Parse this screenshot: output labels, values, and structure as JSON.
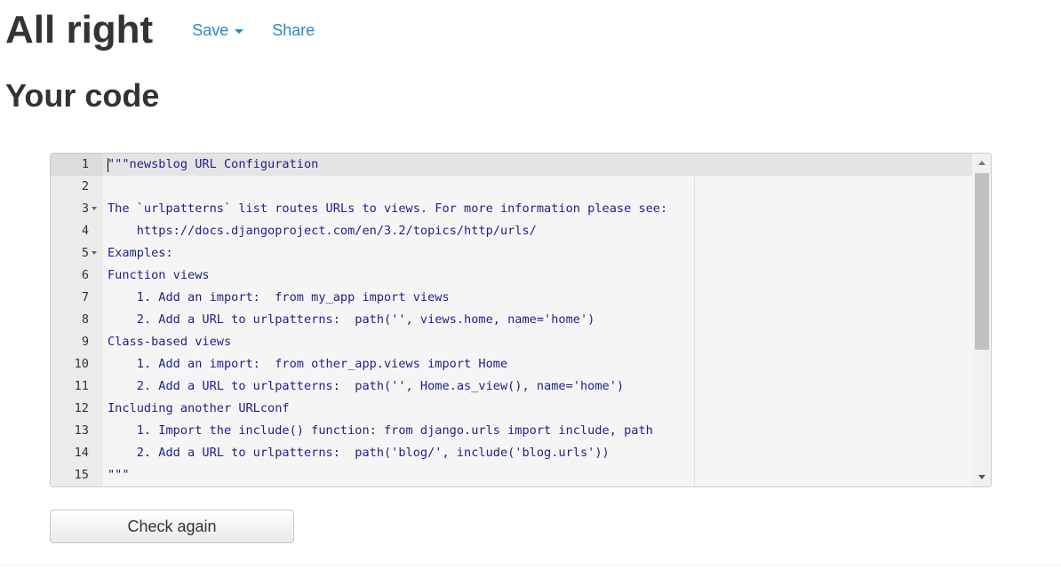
{
  "header": {
    "title": "All right",
    "save_label": "Save",
    "share_label": "Share"
  },
  "section_title": "Your code",
  "editor": {
    "lines": [
      {
        "number": "1",
        "text": "\"\"\"newsblog URL Configuration"
      },
      {
        "number": "2",
        "text": ""
      },
      {
        "number": "3",
        "text": "The `urlpatterns` list routes URLs to views. For more information please see:"
      },
      {
        "number": "4",
        "text": "    https://docs.djangoproject.com/en/3.2/topics/http/urls/"
      },
      {
        "number": "5",
        "text": "Examples:"
      },
      {
        "number": "6",
        "text": "Function views"
      },
      {
        "number": "7",
        "text": "    1. Add an import:  from my_app import views"
      },
      {
        "number": "8",
        "text": "    2. Add a URL to urlpatterns:  path('', views.home, name='home')"
      },
      {
        "number": "9",
        "text": "Class-based views"
      },
      {
        "number": "10",
        "text": "    1. Add an import:  from other_app.views import Home"
      },
      {
        "number": "11",
        "text": "    2. Add a URL to urlpatterns:  path('', Home.as_view(), name='home')"
      },
      {
        "number": "12",
        "text": "Including another URLconf"
      },
      {
        "number": "13",
        "text": "    1. Import the include() function: from django.urls import include, path"
      },
      {
        "number": "14",
        "text": "    2. Add a URL to urlpatterns:  path('blog/', include('blog.urls'))"
      },
      {
        "number": "15",
        "text": "\"\"\""
      }
    ],
    "fold_lines": [
      "3",
      "5"
    ],
    "scroll_fraction_visible": 0.53
  },
  "actions": {
    "check_again_label": "Check again"
  },
  "colors": {
    "link": "#2a8ac0",
    "code_text": "#1f1f8a",
    "heading": "#333333"
  },
  "icons": {
    "save_dropdown": "caret-down-icon",
    "fold": "fold-arrow-icon",
    "scroll_up": "scroll-up-arrow-icon",
    "scroll_down": "scroll-down-arrow-icon"
  }
}
